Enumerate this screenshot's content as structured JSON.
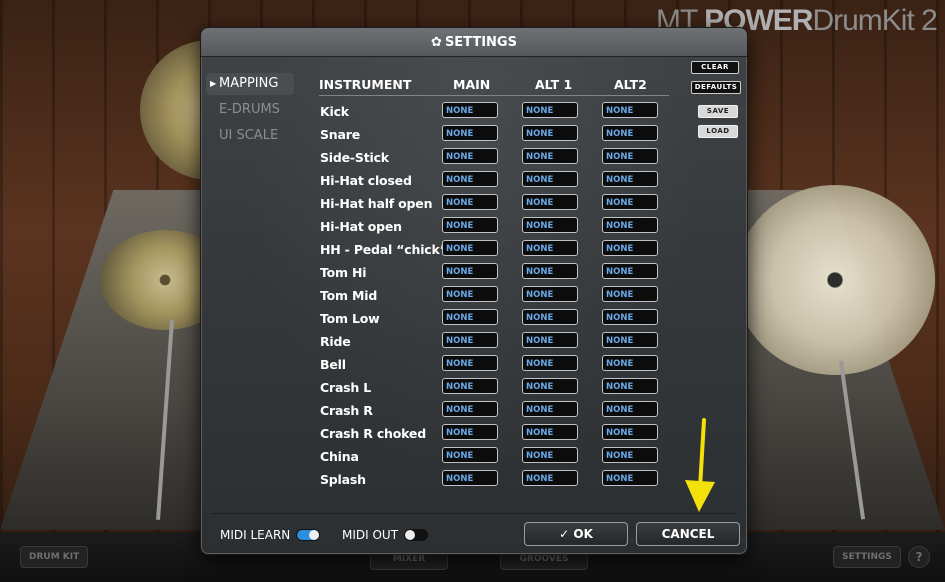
{
  "background": {
    "logo_prefix": "MT",
    "logo_bold": "POWER",
    "logo_suffix": "DrumKit 2",
    "bottom_buttons": {
      "drum_kit": "DRUM KIT",
      "mixer": "MIXER",
      "grooves": "GROOVES",
      "settings": "SETTINGS",
      "help": "?"
    }
  },
  "dialog": {
    "title": "SETTINGS",
    "title_icon": "gear-icon",
    "nav": [
      {
        "label": "MAPPING",
        "active": true
      },
      {
        "label": "E-DRUMS",
        "active": false
      },
      {
        "label": "UI SCALE",
        "active": false
      }
    ],
    "table": {
      "headers": {
        "instrument": "INSTRUMENT",
        "main": "MAIN",
        "alt1": "ALT 1",
        "alt2": "ALT2"
      },
      "rows": [
        {
          "name": "Kick",
          "main": "NONE",
          "alt1": "NONE",
          "alt2": "NONE"
        },
        {
          "name": "Snare",
          "main": "NONE",
          "alt1": "NONE",
          "alt2": "NONE"
        },
        {
          "name": "Side-Stick",
          "main": "NONE",
          "alt1": "NONE",
          "alt2": "NONE"
        },
        {
          "name": "Hi-Hat closed",
          "main": "NONE",
          "alt1": "NONE",
          "alt2": "NONE"
        },
        {
          "name": "Hi-Hat half open",
          "main": "NONE",
          "alt1": "NONE",
          "alt2": "NONE"
        },
        {
          "name": "Hi-Hat open",
          "main": "NONE",
          "alt1": "NONE",
          "alt2": "NONE"
        },
        {
          "name": "HH - Pedal “chick”",
          "main": "NONE",
          "alt1": "NONE",
          "alt2": "NONE"
        },
        {
          "name": "Tom Hi",
          "main": "NONE",
          "alt1": "NONE",
          "alt2": "NONE"
        },
        {
          "name": "Tom Mid",
          "main": "NONE",
          "alt1": "NONE",
          "alt2": "NONE"
        },
        {
          "name": "Tom Low",
          "main": "NONE",
          "alt1": "NONE",
          "alt2": "NONE"
        },
        {
          "name": "Ride",
          "main": "NONE",
          "alt1": "NONE",
          "alt2": "NONE"
        },
        {
          "name": "Bell",
          "main": "NONE",
          "alt1": "NONE",
          "alt2": "NONE"
        },
        {
          "name": "Crash L",
          "main": "NONE",
          "alt1": "NONE",
          "alt2": "NONE"
        },
        {
          "name": "Crash R",
          "main": "NONE",
          "alt1": "NONE",
          "alt2": "NONE"
        },
        {
          "name": "Crash R choked",
          "main": "NONE",
          "alt1": "NONE",
          "alt2": "NONE"
        },
        {
          "name": "China",
          "main": "NONE",
          "alt1": "NONE",
          "alt2": "NONE"
        },
        {
          "name": "Splash",
          "main": "NONE",
          "alt1": "NONE",
          "alt2": "NONE"
        }
      ]
    },
    "side_buttons": {
      "clear": "CLEAR",
      "defaults": "DEFAULTS",
      "save": "SAVE",
      "load": "LOAD"
    },
    "footer": {
      "midi_learn": {
        "label": "MIDI LEARN",
        "on": true
      },
      "midi_out": {
        "label": "MIDI OUT",
        "on": false
      },
      "ok": "OK",
      "ok_icon": "check-icon",
      "cancel": "CANCEL"
    }
  },
  "annotation": {
    "arrow_color": "#f5e10a",
    "arrow_icon": "arrow-down-icon"
  }
}
